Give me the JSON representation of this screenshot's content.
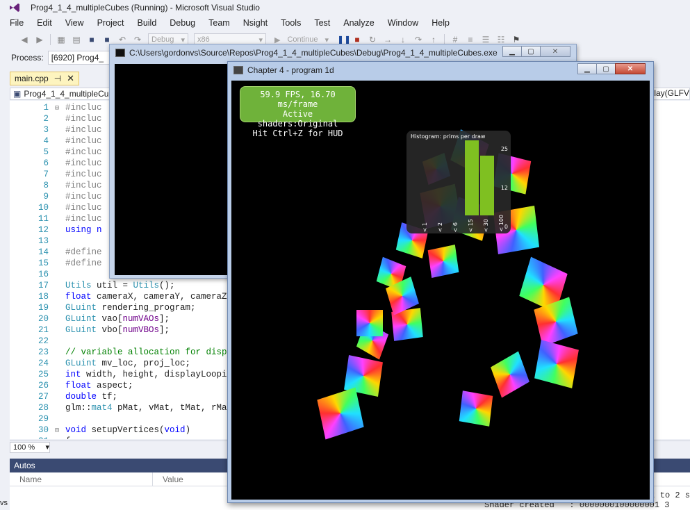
{
  "vs": {
    "title": "Prog4_1_4_multipleCubes (Running) - Microsoft Visual Studio",
    "menu": [
      "File",
      "Edit",
      "View",
      "Project",
      "Build",
      "Debug",
      "Team",
      "Nsight",
      "Tools",
      "Test",
      "Analyze",
      "Window",
      "Help"
    ],
    "toolbar": {
      "config": "Debug",
      "platform": "x86",
      "continue_label": "Continue"
    },
    "process": {
      "label": "Process:",
      "value": "[6920] Prog4_"
    },
    "tab": {
      "label": "main.cpp"
    },
    "nav": {
      "project": "Prog4_1_4_multipleCu",
      "right_scope": "play(GLFV"
    },
    "zoom": "100 %",
    "autos": {
      "title": "Autos",
      "col_name": "Name",
      "col_value": "Value"
    },
    "left_edge_text": "vs",
    "console_tail": {
      "line1": "t to 2 s",
      "line2": "Shader created   : 0000000100000001 3"
    }
  },
  "code": [
    {
      "n": "1",
      "fold": "⊟",
      "segs": [
        {
          "c": "pp",
          "t": "#incluc"
        }
      ]
    },
    {
      "n": "2",
      "fold": "",
      "segs": [
        {
          "c": "pp",
          "t": "#incluc"
        }
      ]
    },
    {
      "n": "3",
      "fold": "",
      "segs": [
        {
          "c": "pp",
          "t": "#incluc"
        }
      ]
    },
    {
      "n": "4",
      "fold": "",
      "segs": [
        {
          "c": "pp",
          "t": "#incluc"
        }
      ]
    },
    {
      "n": "5",
      "fold": "",
      "segs": [
        {
          "c": "pp",
          "t": "#incluc"
        }
      ]
    },
    {
      "n": "6",
      "fold": "",
      "segs": [
        {
          "c": "pp",
          "t": "#incluc"
        }
      ]
    },
    {
      "n": "7",
      "fold": "",
      "segs": [
        {
          "c": "pp",
          "t": "#incluc"
        }
      ]
    },
    {
      "n": "8",
      "fold": "",
      "segs": [
        {
          "c": "pp",
          "t": "#incluc"
        }
      ]
    },
    {
      "n": "9",
      "fold": "",
      "segs": [
        {
          "c": "pp",
          "t": "#incluc"
        }
      ]
    },
    {
      "n": "10",
      "fold": "",
      "segs": [
        {
          "c": "pp",
          "t": "#incluc"
        }
      ]
    },
    {
      "n": "11",
      "fold": "",
      "segs": [
        {
          "c": "pp",
          "t": "#incluc"
        }
      ]
    },
    {
      "n": "12",
      "fold": "",
      "segs": [
        {
          "c": "kw",
          "t": "using n"
        }
      ]
    },
    {
      "n": "13",
      "fold": "",
      "segs": []
    },
    {
      "n": "14",
      "fold": "",
      "segs": [
        {
          "c": "pp",
          "t": "#define"
        }
      ]
    },
    {
      "n": "15",
      "fold": "",
      "segs": [
        {
          "c": "pp",
          "t": "#define"
        }
      ]
    },
    {
      "n": "16",
      "fold": "",
      "segs": []
    },
    {
      "n": "17",
      "fold": "",
      "segs": [
        {
          "c": "ty",
          "t": "Utils"
        },
        {
          "c": "code-default",
          "t": " util = "
        },
        {
          "c": "ty",
          "t": "Utils"
        },
        {
          "c": "code-default",
          "t": "();"
        }
      ]
    },
    {
      "n": "18",
      "fold": "",
      "segs": [
        {
          "c": "kw",
          "t": "float"
        },
        {
          "c": "code-default",
          "t": " cameraX, cameraY, cameraZ"
        }
      ]
    },
    {
      "n": "19",
      "fold": "",
      "segs": [
        {
          "c": "ty",
          "t": "GLuint"
        },
        {
          "c": "code-default",
          "t": " rendering_program;"
        }
      ]
    },
    {
      "n": "20",
      "fold": "",
      "segs": [
        {
          "c": "ty",
          "t": "GLuint"
        },
        {
          "c": "code-default",
          "t": " vao["
        },
        {
          "c": "mc",
          "t": "numVAOs"
        },
        {
          "c": "code-default",
          "t": "];"
        }
      ]
    },
    {
      "n": "21",
      "fold": "",
      "segs": [
        {
          "c": "ty",
          "t": "GLuint"
        },
        {
          "c": "code-default",
          "t": " vbo["
        },
        {
          "c": "mc",
          "t": "numVBOs"
        },
        {
          "c": "code-default",
          "t": "];"
        }
      ]
    },
    {
      "n": "22",
      "fold": "",
      "segs": []
    },
    {
      "n": "23",
      "fold": "",
      "segs": [
        {
          "c": "cm",
          "t": "// variable allocation for disp"
        }
      ]
    },
    {
      "n": "24",
      "fold": "",
      "segs": [
        {
          "c": "ty",
          "t": "GLuint"
        },
        {
          "c": "code-default",
          "t": " mv_loc, proj_loc;"
        }
      ]
    },
    {
      "n": "25",
      "fold": "",
      "segs": [
        {
          "c": "kw",
          "t": "int"
        },
        {
          "c": "code-default",
          "t": " width, height, displayLoopi"
        }
      ]
    },
    {
      "n": "26",
      "fold": "",
      "segs": [
        {
          "c": "kw",
          "t": "float"
        },
        {
          "c": "code-default",
          "t": " aspect;"
        }
      ]
    },
    {
      "n": "27",
      "fold": "",
      "segs": [
        {
          "c": "kw",
          "t": "double"
        },
        {
          "c": "code-default",
          "t": " tf;"
        }
      ]
    },
    {
      "n": "28",
      "fold": "",
      "segs": [
        {
          "c": "code-default",
          "t": "glm::"
        },
        {
          "c": "ty",
          "t": "mat4"
        },
        {
          "c": "code-default",
          "t": " pMat, vMat, tMat, rMa"
        }
      ]
    },
    {
      "n": "29",
      "fold": "",
      "segs": []
    },
    {
      "n": "30",
      "fold": "⊟",
      "segs": [
        {
          "c": "kw",
          "t": "void"
        },
        {
          "c": "code-default",
          "t": " setupVertices("
        },
        {
          "c": "kw",
          "t": "void"
        },
        {
          "c": "code-default",
          "t": ")"
        }
      ]
    },
    {
      "n": "31",
      "fold": "",
      "segs": [
        {
          "c": "code-default",
          "t": "{"
        }
      ]
    }
  ],
  "console": {
    "title": "C:\\Users\\gordonvs\\Source\\Repos\\Prog4_1_4_multipleCubes\\Debug\\Prog4_1_4_multipleCubes.exe"
  },
  "gl": {
    "title": "Chapter 4 - program 1d",
    "hud": {
      "line1": "59.9 FPS, 16.70 ms/frame",
      "line2": "Active shaders:Original",
      "line3": "Hit Ctrl+Z for HUD"
    },
    "histogram": {
      "title": "Histogram: prims per draw",
      "ymax": "25",
      "ymid": "12",
      "ymin": "0",
      "categories": [
        "< 1",
        "< 2",
        "< 6",
        "< 15",
        "< 30",
        "< 100"
      ],
      "values": [
        0,
        0,
        0,
        25,
        20,
        0
      ]
    }
  }
}
